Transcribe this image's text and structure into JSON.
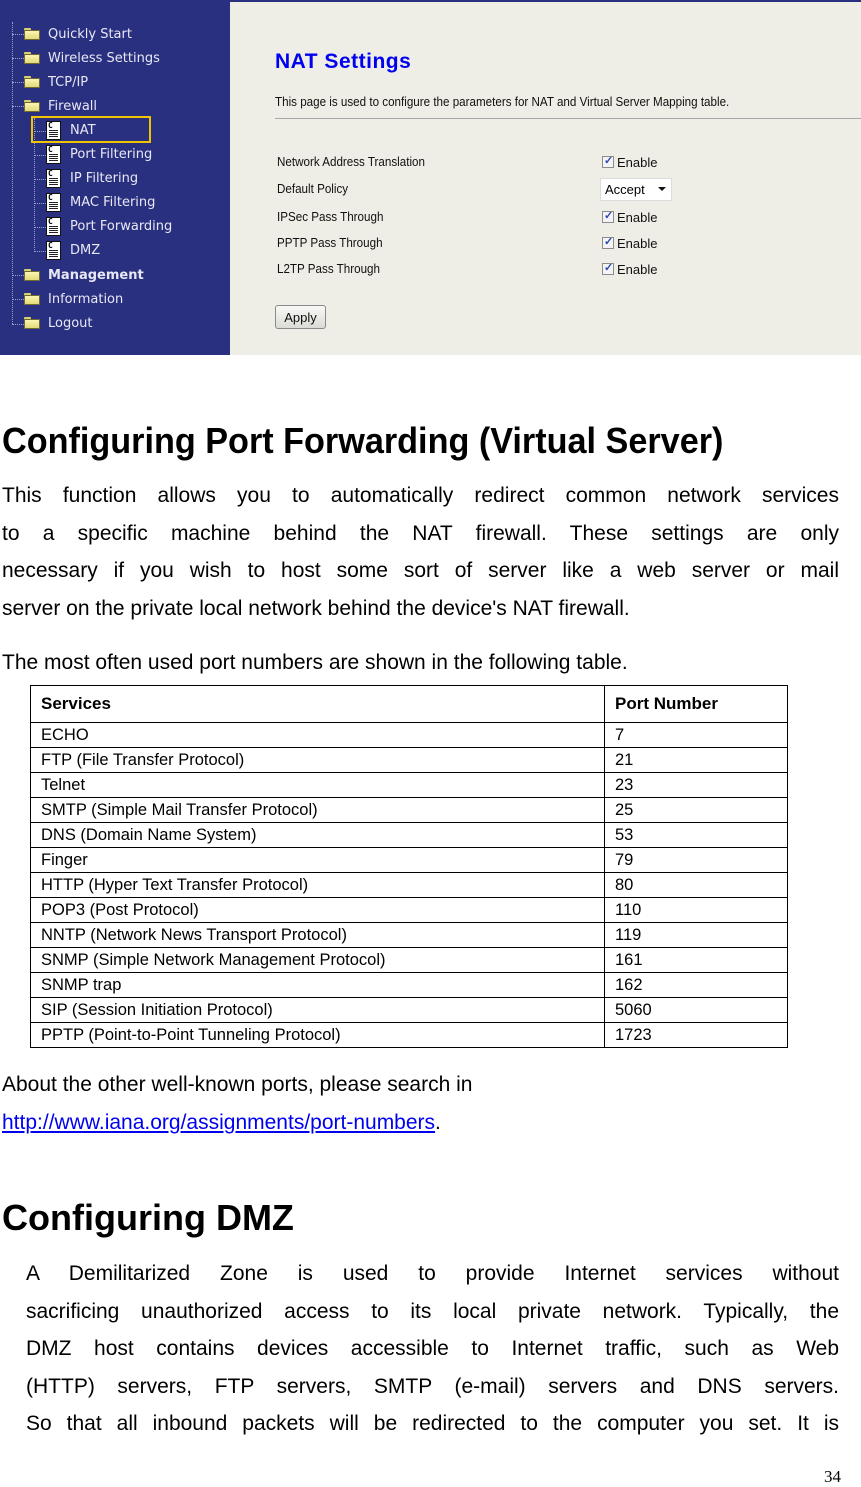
{
  "router_ui": {
    "sidebar": {
      "items": [
        {
          "label": "Quickly Start",
          "type": "folder"
        },
        {
          "label": "Wireless Settings",
          "type": "folder"
        },
        {
          "label": "TCP/IP",
          "type": "folder"
        },
        {
          "label": "Firewall",
          "type": "folder-open"
        },
        {
          "label": "NAT",
          "type": "page",
          "highlighted": true
        },
        {
          "label": "Port Filtering",
          "type": "page"
        },
        {
          "label": "IP Filtering",
          "type": "page"
        },
        {
          "label": "MAC Filtering",
          "type": "page"
        },
        {
          "label": "Port Forwarding",
          "type": "page"
        },
        {
          "label": "DMZ",
          "type": "page"
        },
        {
          "label": "Management",
          "type": "folder",
          "bold": true
        },
        {
          "label": "Information",
          "type": "folder"
        },
        {
          "label": "Logout",
          "type": "folder"
        }
      ],
      "highlight_color": "#f0c400",
      "background_color": "#2a3080"
    },
    "panel": {
      "title": "NAT Settings",
      "description": "This page is used to configure the parameters for NAT and Virtual Server Mapping table.",
      "title_color": "#0000f0",
      "fields": [
        {
          "label": "Network Address Translation",
          "control": "checkbox",
          "checked": true,
          "option_label": "Enable"
        },
        {
          "label": "Default Policy",
          "control": "select",
          "value": "Accept"
        },
        {
          "label": "IPSec Pass Through",
          "control": "checkbox",
          "checked": true,
          "option_label": "Enable"
        },
        {
          "label": "PPTP Pass Through",
          "control": "checkbox",
          "checked": true,
          "option_label": "Enable"
        },
        {
          "label": "L2TP Pass Through",
          "control": "checkbox",
          "checked": true,
          "option_label": "Enable"
        }
      ],
      "apply_label": "Apply"
    }
  },
  "port_forwarding": {
    "heading": "Configuring Port Forwarding (Virtual Server)",
    "intro_lines": [
      "This function allows you to automatically redirect common network services",
      "to a specific machine behind the NAT firewall. These settings are only",
      "necessary if you wish to host some sort of server like a web server or mail",
      "server on the private local network behind the device's NAT firewall."
    ],
    "table_intro": "The most often used port numbers are shown in the following table.",
    "table": {
      "headers": [
        "Services",
        "Port Number"
      ],
      "rows": [
        [
          "ECHO",
          "7"
        ],
        [
          "FTP (File Transfer Protocol)",
          "21"
        ],
        [
          "Telnet",
          "23"
        ],
        [
          "SMTP (Simple Mail Transfer Protocol)",
          "25"
        ],
        [
          "DNS (Domain Name System)",
          "53"
        ],
        [
          "Finger",
          "79"
        ],
        [
          "HTTP (Hyper Text Transfer Protocol)",
          "80"
        ],
        [
          "POP3 (Post Protocol)",
          "110"
        ],
        [
          "NNTP (Network News Transport Protocol)",
          "119"
        ],
        [
          "SNMP (Simple Network Management Protocol)",
          "161"
        ],
        [
          "SNMP trap",
          "162"
        ],
        [
          "SIP (Session Initiation Protocol)",
          "5060"
        ],
        [
          "PPTP (Point-to-Point Tunneling Protocol)",
          "1723"
        ]
      ]
    },
    "more_info": "About the other well-known ports, please search in",
    "link_text": "http://www.iana.org/assignments/port-numbers",
    "link_suffix": ".",
    "link_color": "#0000ee"
  },
  "dmz": {
    "heading": "Configuring DMZ",
    "lines": [
      "A Demilitarized Zone is used to provide Internet services without",
      "sacrificing unauthorized access to its local private network. Typically, the",
      "DMZ host contains devices accessible to Internet traffic, such as Web",
      "(HTTP) servers, FTP servers, SMTP (e-mail) servers and DNS servers.",
      "So that all inbound packets will be redirected to the computer you set. It is"
    ]
  },
  "page_number": "34"
}
